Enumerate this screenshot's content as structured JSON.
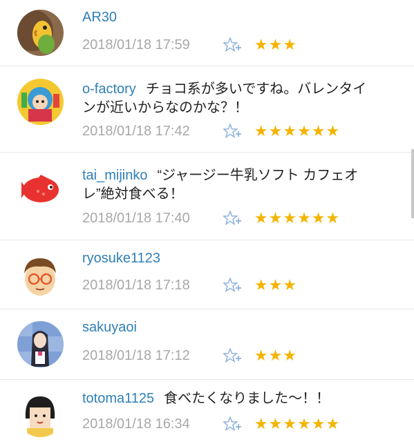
{
  "comments": [
    {
      "user": "AR30",
      "text_lines": [
        ""
      ],
      "time": "2018/01/18 17:59",
      "stars": "★★★"
    },
    {
      "user": "o-factory",
      "text_lines": [
        "チョコ系が多いですね。バレンタイ",
        "ンが近いからなのかな？！"
      ],
      "time": "2018/01/18 17:42",
      "stars": "★★★★★★"
    },
    {
      "user": "tai_mijinko",
      "text_lines": [
        "“ジャージー牛乳ソフト カフェオ",
        "レ”絶対食べる！"
      ],
      "time": "2018/01/18 17:40",
      "stars": "★★★★★★"
    },
    {
      "user": "ryosuke1123",
      "text_lines": [
        ""
      ],
      "time": "2018/01/18 17:18",
      "stars": "★★★"
    },
    {
      "user": "sakuyaoi",
      "text_lines": [
        ""
      ],
      "time": "2018/01/18 17:12",
      "stars": "★★★"
    },
    {
      "user": "totoma1125",
      "text_lines": [
        "食べたくなりました〜！！"
      ],
      "time": "2018/01/18 16:34",
      "stars": "★★★★★★"
    }
  ],
  "icons": {
    "favorite": "star-plus-icon"
  },
  "colors": {
    "username": "#2f7fb7",
    "timestamp": "#a8a8a8",
    "star": "#f4b400",
    "fav_icon": "#8fb3dd"
  }
}
